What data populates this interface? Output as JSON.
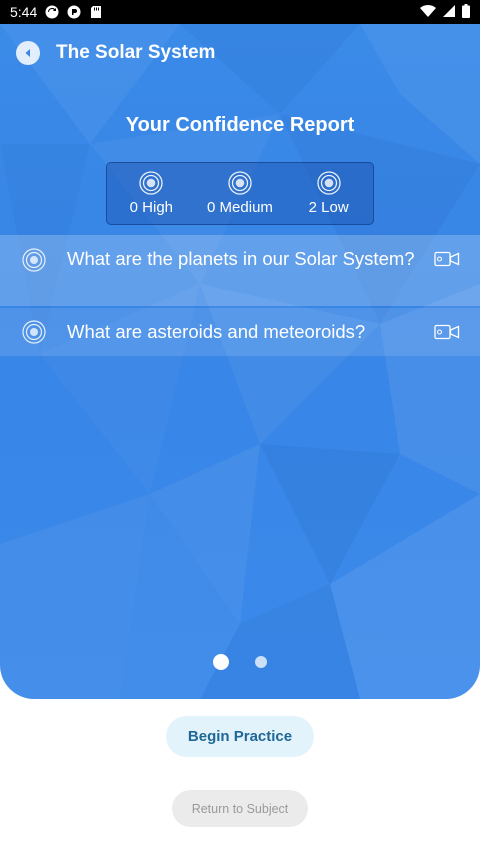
{
  "status_bar": {
    "time": "5:44",
    "left_icons": [
      "sync-icon",
      "pocket-icon",
      "sd-card-icon"
    ],
    "right_icons": [
      "wifi-icon",
      "signal-icon",
      "battery-icon"
    ]
  },
  "header": {
    "title": "The Solar System",
    "back_icon": "back-arrow-icon"
  },
  "report": {
    "title": "Your Confidence Report",
    "levels": [
      {
        "label": "0 High"
      },
      {
        "label": "0 Medium"
      },
      {
        "label": "2 Low"
      }
    ]
  },
  "questions": [
    {
      "text": "What are the planets in our Solar System?",
      "icon": "video-camera-icon"
    },
    {
      "text": "What are asteroids and meteoroids?",
      "icon": "video-camera-icon"
    }
  ],
  "pager": {
    "pages": 2,
    "active": 0
  },
  "actions": {
    "begin_label": "Begin Practice",
    "return_label": "Return to Subject"
  },
  "colors": {
    "hero_blue": "#3785e6",
    "begin_bg": "#e3f3fc",
    "begin_text": "#1e6796",
    "return_bg": "#ebebeb",
    "return_text": "#9a9a9a"
  }
}
